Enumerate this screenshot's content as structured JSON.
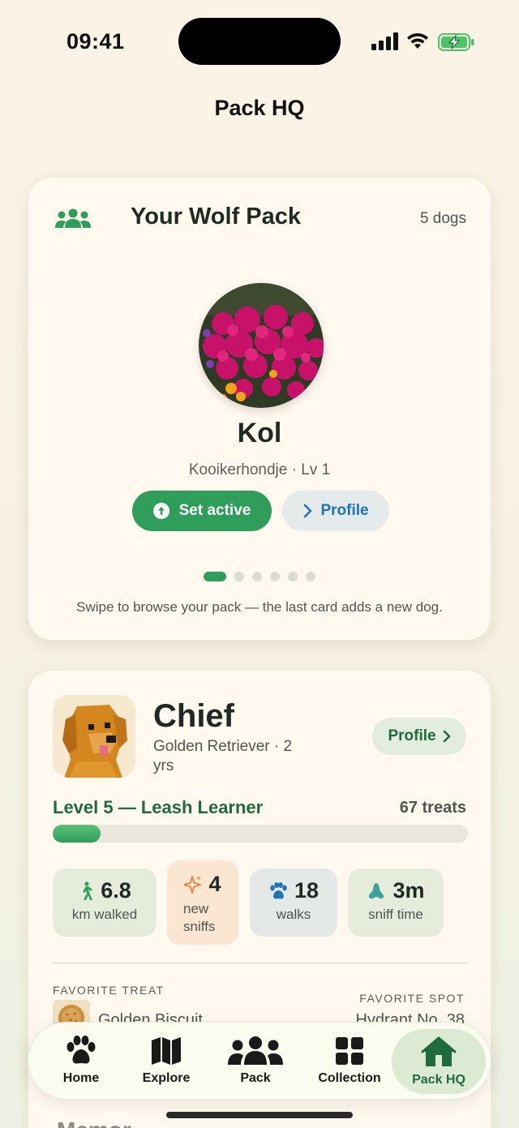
{
  "status_bar": {
    "time": "09:41"
  },
  "page_title": "Pack HQ",
  "pack_card": {
    "title": "Your Wolf Pack",
    "count": "5 dogs",
    "current_dog": {
      "name": "Kol",
      "subtitle": "Kooikerhondje · Lv 1"
    },
    "set_active_label": "Set active",
    "profile_label": "Profile",
    "page_dots": 6,
    "active_dot": 0,
    "hint": "Swipe to browse your pack — the last card adds a new dog."
  },
  "chief_card": {
    "name": "Chief",
    "breed": "Golden Retriever · 2 yrs",
    "profile_label": "Profile",
    "level_title": "Level 5 — Leash Learner",
    "treats": "67 treats",
    "level_progress": 0.115,
    "stats": [
      {
        "icon": "walking-icon",
        "value": "6.8",
        "label": "km walked"
      },
      {
        "icon": "sparkle-icon",
        "value": "4",
        "label": "new sniffs"
      },
      {
        "icon": "paw-icon",
        "value": "18",
        "label": "walks"
      },
      {
        "icon": "nose-icon",
        "value": "3m",
        "label": "sniff time"
      }
    ],
    "favorite_treat_label": "FAVORITE TREAT",
    "favorite_treat": "Golden Biscuit",
    "favorite_spot_label": "FAVORITE SPOT",
    "favorite_spot": "Hydrant No. 38"
  },
  "next_section_peek": "Memor",
  "tabbar": {
    "tabs": [
      {
        "label": "Home",
        "icon": "paw-icon"
      },
      {
        "label": "Explore",
        "icon": "map-icon"
      },
      {
        "label": "Pack",
        "icon": "group-icon"
      },
      {
        "label": "Collection",
        "icon": "grid-icon"
      },
      {
        "label": "Pack HQ",
        "icon": "house-icon",
        "active": true
      }
    ]
  },
  "colors": {
    "accent": "#2f9e5a",
    "accent_dark": "#1e6b3d",
    "link": "#1e72b8",
    "background": "#fbf3e6"
  }
}
